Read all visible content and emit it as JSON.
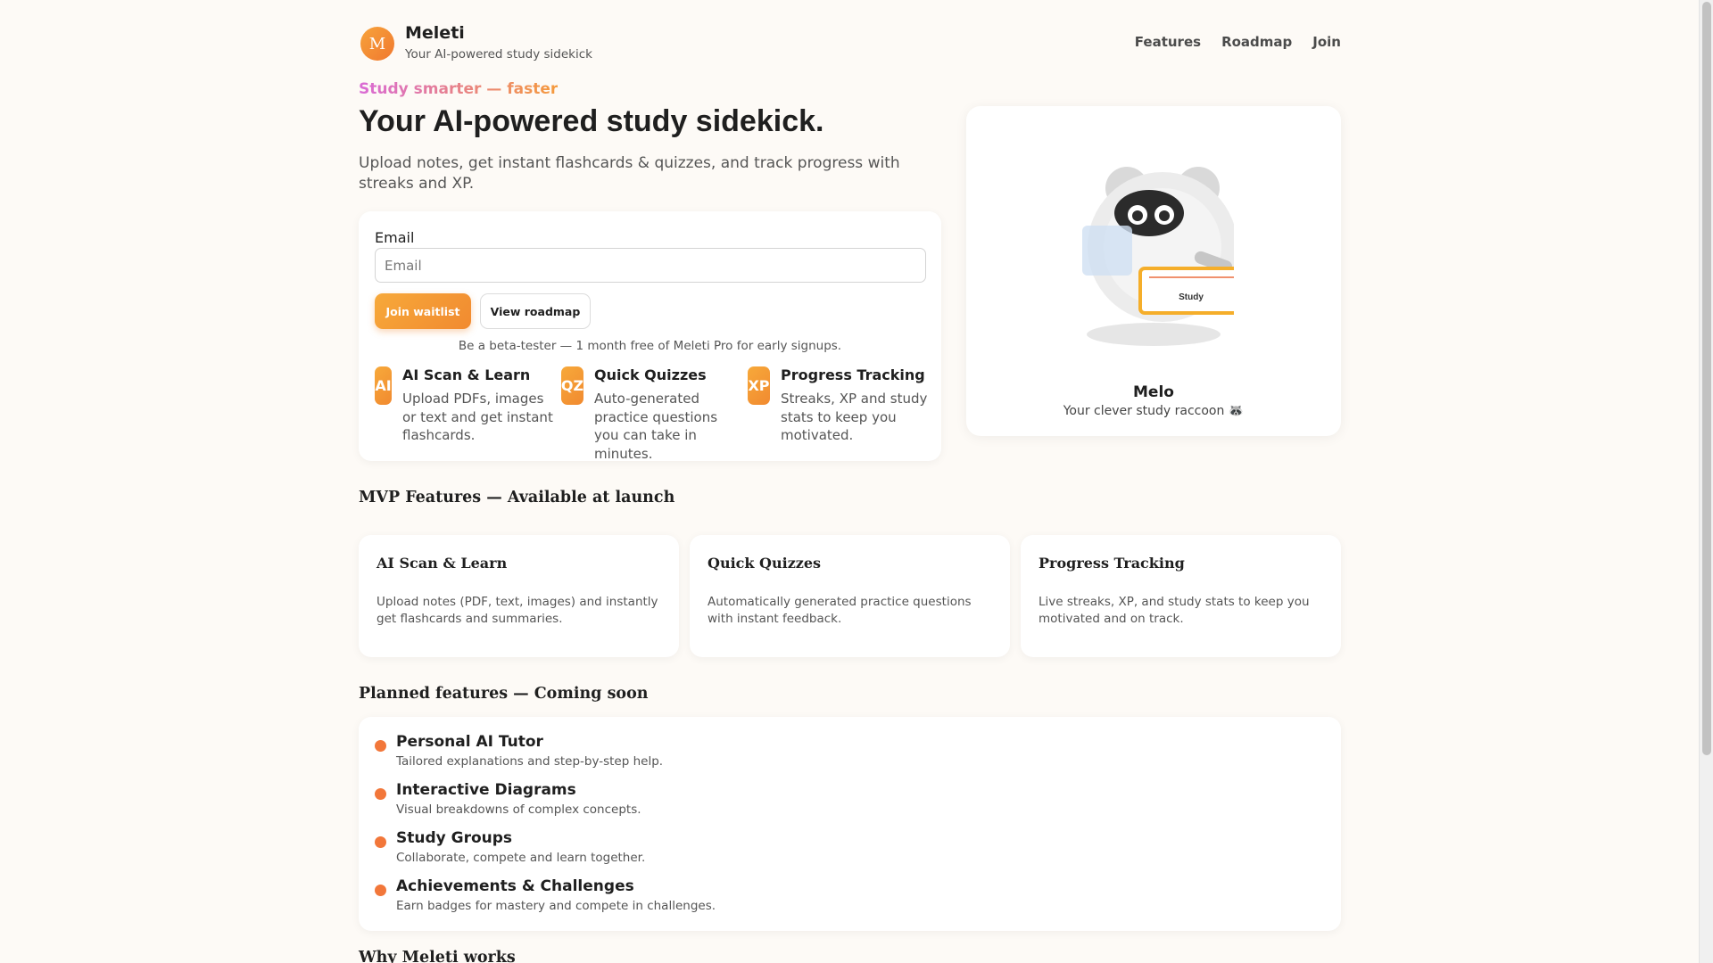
{
  "header": {
    "logo_letter": "M",
    "brand_name": "Meleti",
    "brand_tagline": "Your AI-powered study sidekick",
    "nav": [
      "Features",
      "Roadmap",
      "Join"
    ]
  },
  "hero": {
    "eyebrow": "Study smarter — faster",
    "title": "Your AI-powered study sidekick.",
    "subtitle": "Upload notes, get instant flashcards & quizzes, and track progress with streaks and XP."
  },
  "signup": {
    "email_label": "Email",
    "email_placeholder": "Email",
    "email_value": "",
    "join_label": "Join waitlist",
    "roadmap_label": "View roadmap",
    "beta_note": "Be a beta-tester — 1 month free of Meleti Pro for early signups.",
    "mini_features": [
      {
        "badge": "AI",
        "title": "AI Scan & Learn",
        "desc": "Upload PDFs, images or text and get instant flashcards."
      },
      {
        "badge": "QZ",
        "title": "Quick Quizzes",
        "desc": "Auto-generated practice questions you can take in minutes."
      },
      {
        "badge": "XP",
        "title": "Progress Tracking",
        "desc": "Streaks, XP and study stats to keep you motivated."
      }
    ]
  },
  "mascot": {
    "board_label": "Study",
    "name": "Melo",
    "tagline": "Your clever study raccoon 🦝"
  },
  "mvp": {
    "title": "MVP Features — Available at launch",
    "cards": [
      {
        "title": "AI Scan & Learn",
        "desc": "Upload notes (PDF, text, images) and instantly get flashcards and summaries."
      },
      {
        "title": "Quick Quizzes",
        "desc": "Automatically generated practice questions with instant feedback."
      },
      {
        "title": "Progress Tracking",
        "desc": "Live streaks, XP, and study stats to keep you motivated and on track."
      }
    ]
  },
  "planned": {
    "title": "Planned features — Coming soon",
    "items": [
      {
        "title": "Personal AI Tutor",
        "desc": "Tailored explanations and step-by-step help."
      },
      {
        "title": "Interactive Diagrams",
        "desc": "Visual breakdowns of complex concepts."
      },
      {
        "title": "Study Groups",
        "desc": "Collaborate, compete and learn together."
      },
      {
        "title": "Achievements & Challenges",
        "desc": "Earn badges for mastery and compete in challenges."
      }
    ]
  },
  "why": {
    "title": "Why Meleti works"
  },
  "colors": {
    "accent_orange": "#f18a30",
    "dot_orange": "#f2773a",
    "eyebrow_gradient_start": "#d96ad6",
    "page_background": "#fdfaf6"
  }
}
